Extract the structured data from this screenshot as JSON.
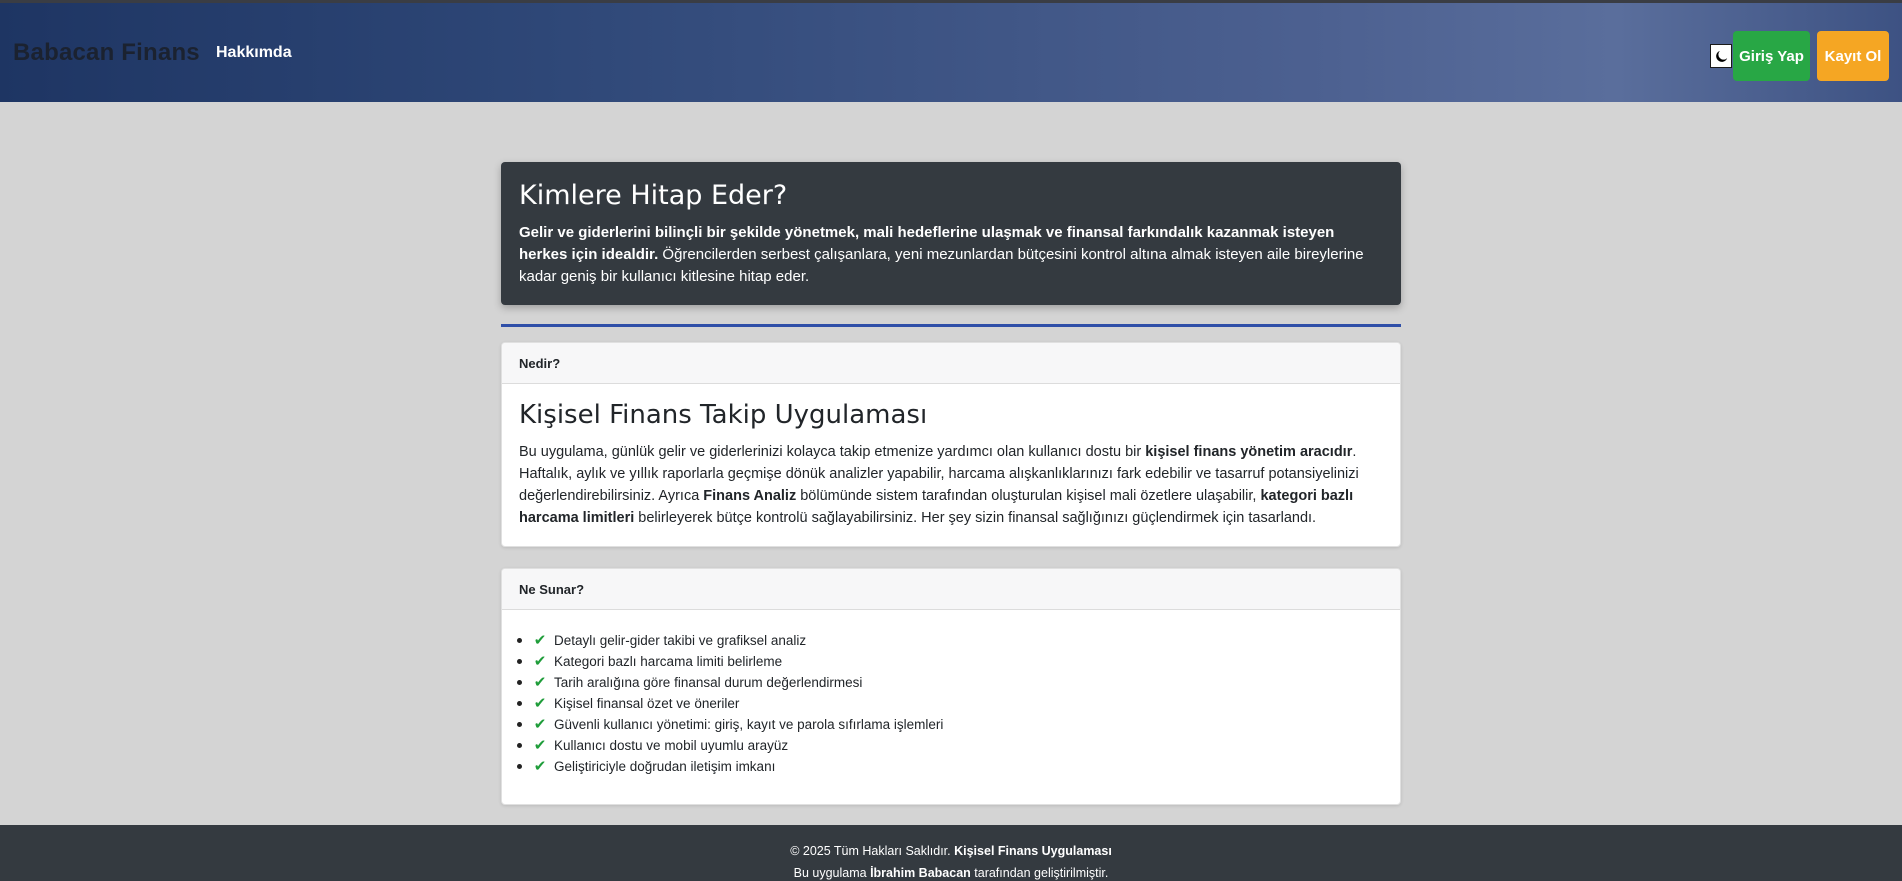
{
  "navbar": {
    "brand": "Babacan Finans",
    "links": [
      "Hakkımda"
    ],
    "theme_toggle_icon": "moon-icon",
    "login_label": "Giriş Yap",
    "register_label": "Kayıt Ol",
    "colors": {
      "login": "#28a745",
      "register": "#f5a623"
    }
  },
  "hero": {
    "title": "Kimlere Hitap Eder?",
    "text_bold": "Gelir ve giderlerini bilinçli bir şekilde yönetmek, mali hedeflerine ulaşmak ve finansal farkındalık kazanmak isteyen herkes için idealdir.",
    "text_rest": " Öğrencilerden serbest çalışanlara, yeni mezunlardan bütçesini kontrol altına almak isteyen aile bireylerine kadar geniş bir kullanıcı kitlesine hitap eder."
  },
  "what_is": {
    "header": "Nedir?",
    "title": "Kişisel Finans Takip Uygulaması",
    "p1": "Bu uygulama, günlük gelir ve giderlerinizi kolayca takip etmenize yardımcı olan kullanıcı dostu bir ",
    "b1": "kişisel finans yönetim aracıdır",
    "p2": ". Haftalık, aylık ve yıllık raporlarla geçmişe dönük analizler yapabilir, harcama alışkanlıklarınızı fark edebilir ve tasarruf potansiyelinizi değerlendirebilirsiniz. Ayrıca ",
    "b2": "Finans Analiz",
    "p3": " bölümünde sistem tarafından oluşturulan kişisel mali özetlere ulaşabilir, ",
    "b3": "kategori bazlı harcama limitleri",
    "p4": " belirleyerek bütçe kontrolü sağlayabilirsiniz. Her şey sizin finansal sağlığınızı güçlendirmek için tasarlandı."
  },
  "features": {
    "header": "Ne Sunar?",
    "icon": "check-icon",
    "items": [
      "Detaylı gelir-gider takibi ve grafiksel analiz",
      "Kategori bazlı harcama limiti belirleme",
      "Tarih aralığına göre finansal durum değerlendirmesi",
      "Kişisel finansal özet ve öneriler",
      "Güvenli kullanıcı yönetimi: giriş, kayıt ve parola sıfırlama işlemleri",
      "Kullanıcı dostu ve mobil uyumlu arayüz",
      "Geliştiriciyle doğrudan iletişim imkanı"
    ]
  },
  "footer": {
    "line1_prefix": "© 2025 Tüm Hakları Saklıdır. ",
    "line1_bold": "Kişisel Finans Uygulaması",
    "line2_prefix": "Bu uygulama ",
    "line2_bold": "İbrahim Babacan",
    "line2_suffix": " tarafından geliştirilmiştir."
  }
}
